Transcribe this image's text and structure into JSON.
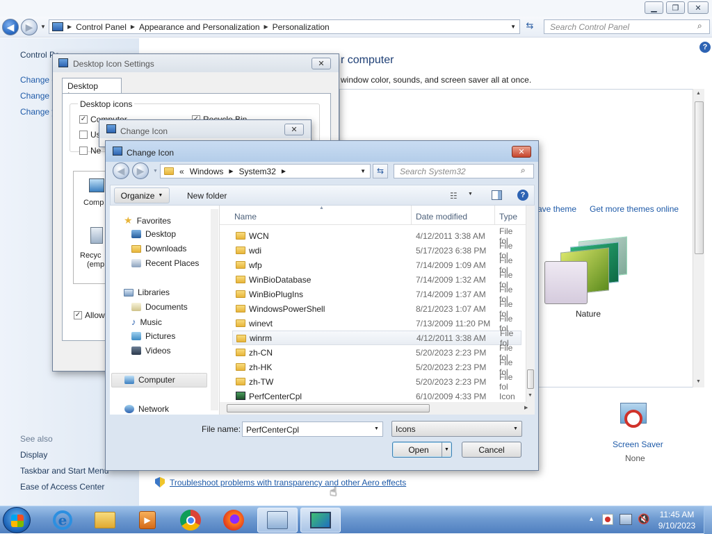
{
  "explorer": {
    "breadcrumb": [
      "Control Panel",
      "Appearance and Personalization",
      "Personalization"
    ],
    "search_placeholder": "Search Control Panel",
    "left_links": [
      "Control Pa",
      "Change d",
      "Change m",
      "Change y"
    ],
    "see_also_title": "See also",
    "see_also": [
      "Display",
      "Taskbar and Start Menu",
      "Ease of Access Center"
    ],
    "heading_fragment": "r computer",
    "subtitle_fragment": "window color, sounds, and screen saver all at once.",
    "save_theme_fragment": "ave theme",
    "get_more_themes": "Get more themes online",
    "theme_name": "Nature",
    "screen_saver_label": "Screen Saver",
    "screen_saver_value": "None",
    "troubleshoot_link": "Troubleshoot problems with transparency and other Aero effects"
  },
  "desktop_icon_settings": {
    "title": "Desktop Icon Settings",
    "tab": "Desktop Icons",
    "group_label": "Desktop icons",
    "checkboxes": [
      {
        "label": "Computer",
        "checked": "✓"
      },
      {
        "label": "Use",
        "checked": ""
      },
      {
        "label": "Ne",
        "checked": ""
      }
    ],
    "recycle_bin_label": "Recycle Bin",
    "icon_labels": [
      "Comp",
      "Recyc",
      "(emp"
    ],
    "allow_label": "Allow"
  },
  "change_icon_back": {
    "title": "Change Icon"
  },
  "change_icon": {
    "title": "Change Icon",
    "path": [
      "Windows",
      "System32"
    ],
    "path_prefix": "«",
    "search_placeholder": "Search System32",
    "organize": "Organize",
    "new_folder": "New folder",
    "nav": {
      "favorites": "Favorites",
      "favorites_items": [
        "Desktop",
        "Downloads",
        "Recent Places"
      ],
      "libraries": "Libraries",
      "libraries_items": [
        "Documents",
        "Music",
        "Pictures",
        "Videos"
      ],
      "computer": "Computer",
      "network": "Network"
    },
    "columns": {
      "name": "Name",
      "date": "Date modified",
      "type": "Type"
    },
    "rows": [
      {
        "name": "WCN",
        "date": "4/12/2011 3:38 AM",
        "type": "File fol"
      },
      {
        "name": "wdi",
        "date": "5/17/2023 6:38 PM",
        "type": "File fol"
      },
      {
        "name": "wfp",
        "date": "7/14/2009 1:09 AM",
        "type": "File fol"
      },
      {
        "name": "WinBioDatabase",
        "date": "7/14/2009 1:32 AM",
        "type": "File fol"
      },
      {
        "name": "WinBioPlugIns",
        "date": "7/14/2009 1:37 AM",
        "type": "File fol"
      },
      {
        "name": "WindowsPowerShell",
        "date": "8/21/2023 1:07 AM",
        "type": "File fol"
      },
      {
        "name": "winevt",
        "date": "7/13/2009 11:20 PM",
        "type": "File fol"
      },
      {
        "name": "winrm",
        "date": "4/12/2011 3:38 AM",
        "type": "File fol"
      },
      {
        "name": "zh-CN",
        "date": "5/20/2023 2:23 PM",
        "type": "File fol"
      },
      {
        "name": "zh-HK",
        "date": "5/20/2023 2:23 PM",
        "type": "File fol"
      },
      {
        "name": "zh-TW",
        "date": "5/20/2023 2:23 PM",
        "type": "File fol"
      },
      {
        "name": "PerfCenterCpl",
        "date": "6/10/2009 4:33 PM",
        "type": "Icon"
      }
    ],
    "file_name_label": "File name:",
    "file_name_value": "PerfCenterCpl",
    "filter_value": "Icons",
    "open_button": "Open",
    "cancel_button": "Cancel"
  },
  "taskbar": {
    "time": "11:45 AM",
    "date": "9/10/2023"
  }
}
